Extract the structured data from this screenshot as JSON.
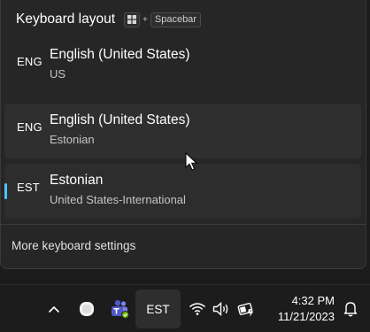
{
  "flyout": {
    "title": "Keyboard layout",
    "shortcut": {
      "plus": "+",
      "key": "Spacebar"
    },
    "items": [
      {
        "code": "ENG",
        "name": "English (United States)",
        "layout": "US",
        "state": "normal"
      },
      {
        "code": "ENG",
        "name": "English (United States)",
        "layout": "Estonian",
        "state": "hover"
      },
      {
        "code": "EST",
        "name": "Estonian",
        "layout": "United States-International",
        "state": "selected"
      }
    ],
    "more_settings": "More keyboard settings"
  },
  "taskbar": {
    "icons": [
      "chevron-up-icon",
      "app-circle-icon",
      "teams-icon",
      "wifi-icon",
      "volume-icon",
      "battery-icon",
      "notification-bell-icon"
    ],
    "language": "EST",
    "time": "4:32 PM",
    "date": "11/21/2023"
  },
  "colors": {
    "accent": "#4cc2ff",
    "flyout_bg": "#262626",
    "taskbar_bg": "#1c1c1c"
  }
}
